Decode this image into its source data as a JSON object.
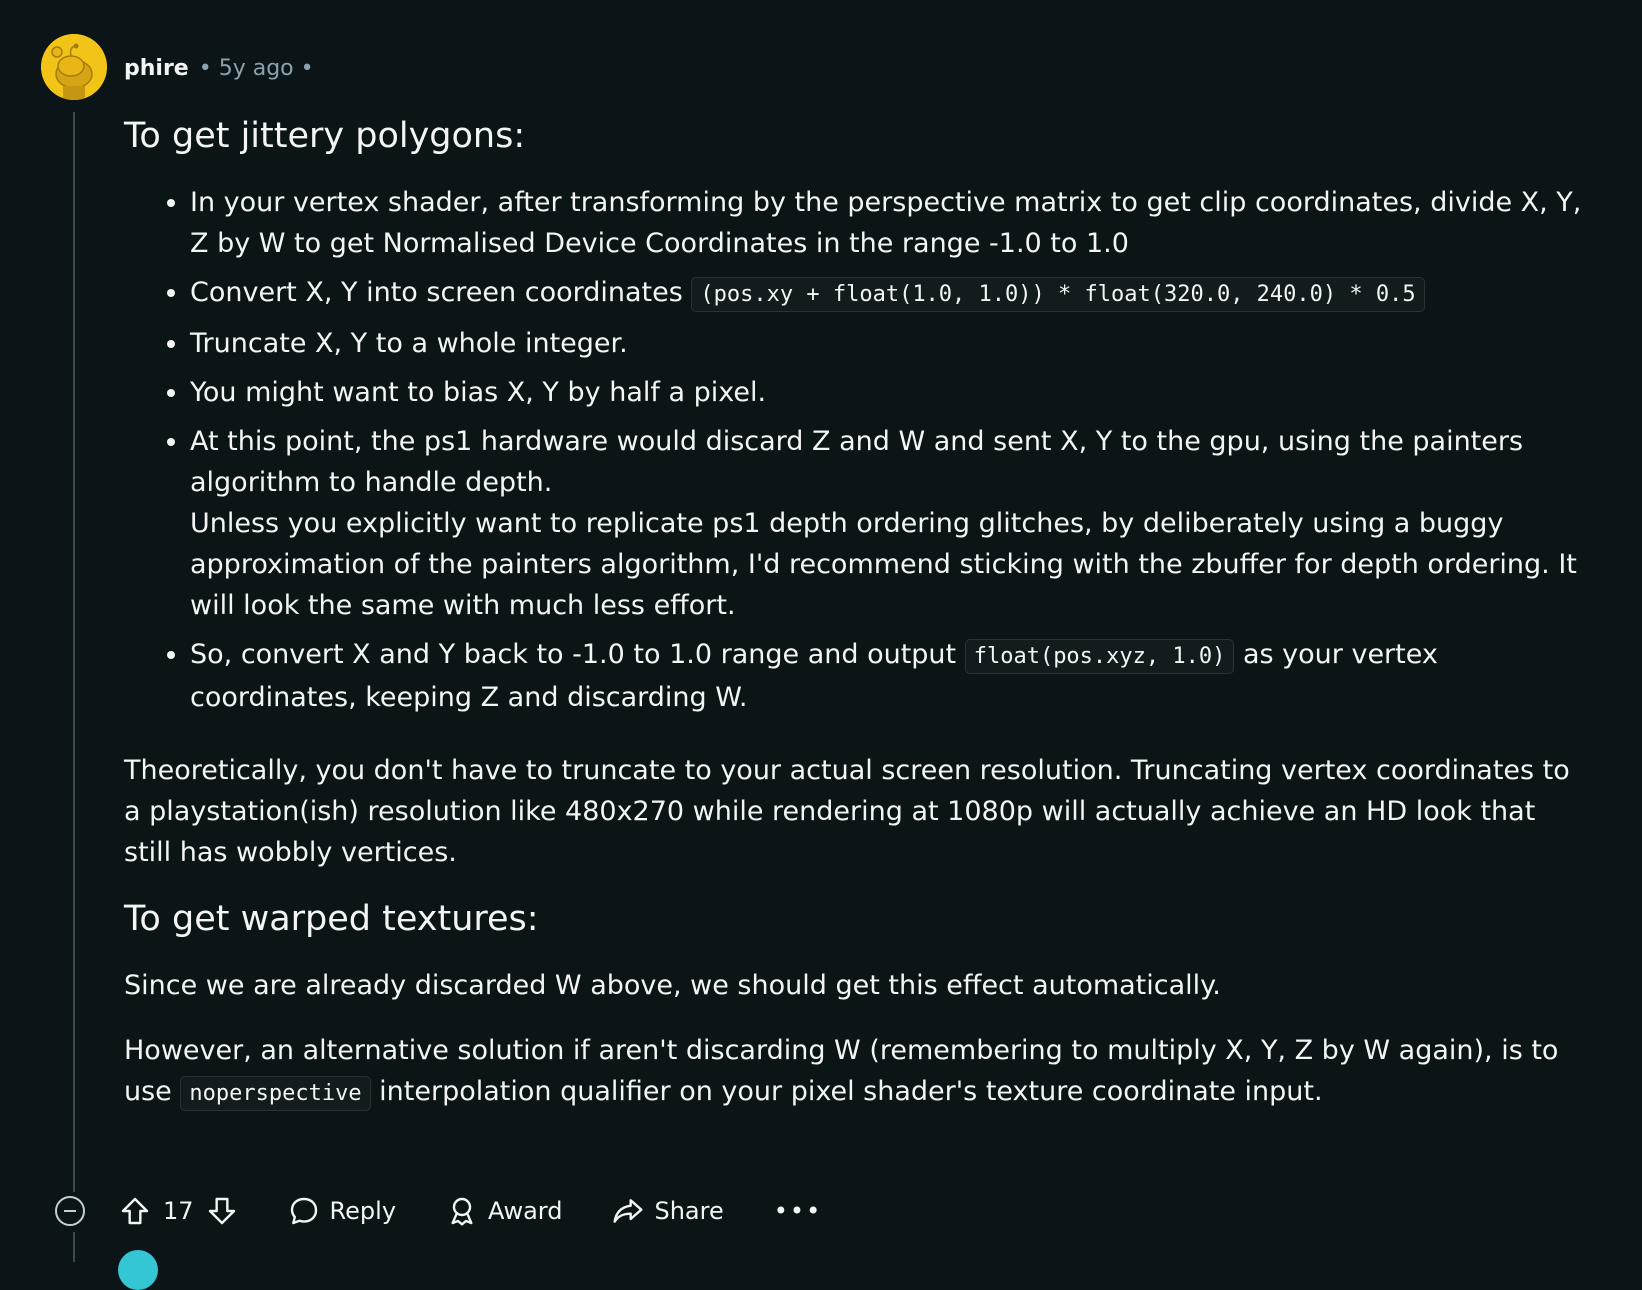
{
  "author": {
    "name": "phire",
    "time": "• 5y ago •"
  },
  "heading_polygons": "To get jittery polygons:",
  "bullets": {
    "b1": "In your vertex shader, after transforming by the perspective matrix to get clip coordinates, divide X, Y, Z by W to get Normalised Device Coordinates in the range -1.0 to 1.0",
    "b2_text": "Convert X, Y into screen coordinates",
    "b2_code": "(pos.xy + float(1.0, 1.0)) * float(320.0, 240.0) * 0.5",
    "b3": "Truncate X, Y to a whole integer.",
    "b4": "You might want to bias X, Y by half a pixel.",
    "b5_line1": "At this point, the ps1 hardware would discard Z and W and sent X, Y to the gpu, using the painters algorithm to handle depth.",
    "b5_line2": "Unless you explicitly want to replicate ps1 depth ordering glitches, by deliberately using a buggy approximation of the painters algorithm, I'd recommend sticking with the zbuffer for depth ordering. It will look the same with much less effort.",
    "b6_before": "So, convert X and Y back to -1.0 to 1.0 range and output",
    "b6_code": "float(pos.xyz, 1.0)",
    "b6_after": "as your vertex coordinates, keeping Z and discarding W."
  },
  "para_theoretically": "Theoretically, you don't have to truncate to your actual screen resolution. Truncating vertex coordinates to a playstation(ish) resolution like 480x270 while rendering at 1080p will actually achieve an HD look that still has wobbly vertices.",
  "heading_textures": "To get warped textures:",
  "para_since": "Since we are already discarded W above, we should get this effect automatically.",
  "para_however_before": "However, an alternative solution if aren't discarding W (remembering to multiply X, Y, Z by W again), is to use",
  "para_however_code": "noperspective",
  "para_however_after": "interpolation qualifier on your pixel shader's texture coordinate input.",
  "actions": {
    "vote_count": "17",
    "reply": "Reply",
    "award": "Award",
    "share": "Share",
    "more": "•••"
  },
  "colors": {
    "background": "#0b1416",
    "text": "#f2f4f5",
    "meta": "#8ba2ad",
    "avatar": "#f2c418"
  }
}
